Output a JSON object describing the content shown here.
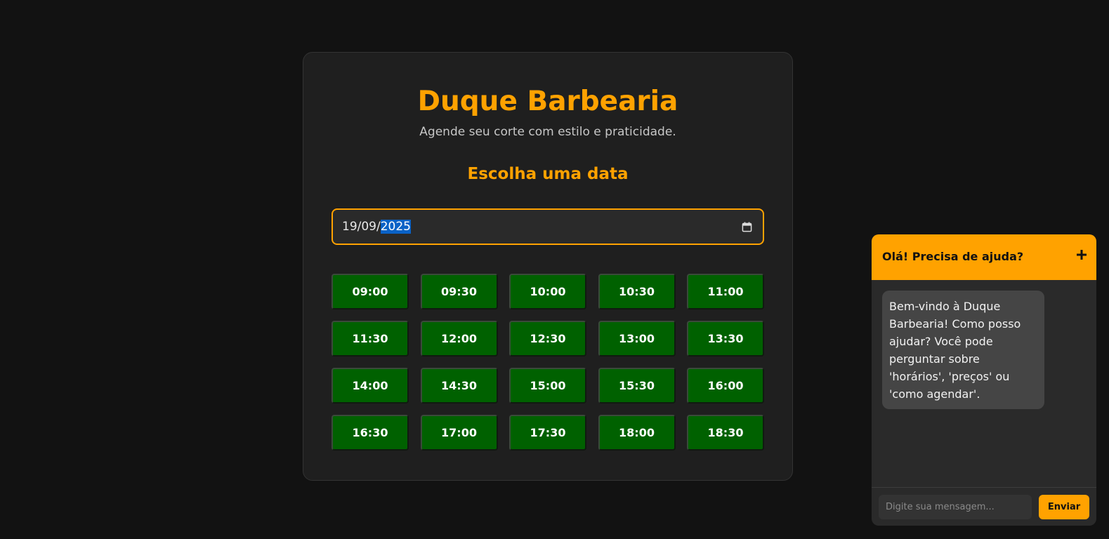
{
  "colors": {
    "background": "#121212",
    "card": "#1f1f1f",
    "accent": "#ffa200",
    "slot_available": "#006100",
    "chat_panel": "#2a2a2a",
    "bubble": "#454545"
  },
  "header": {
    "title": "Duque Barbearia",
    "subtitle": "Agende seu corte com estilo e praticidade."
  },
  "booking": {
    "section_title": "Escolha uma data",
    "date": {
      "day_month": "19/09/",
      "year": "2025",
      "icon": "calendar-icon"
    },
    "slots": [
      "09:00",
      "09:30",
      "10:00",
      "10:30",
      "11:00",
      "11:30",
      "12:00",
      "12:30",
      "13:00",
      "13:30",
      "14:00",
      "14:30",
      "15:00",
      "15:30",
      "16:00",
      "16:30",
      "17:00",
      "17:30",
      "18:00",
      "18:30"
    ]
  },
  "chat": {
    "header_title": "Olá! Precisa de ajuda?",
    "toggle_icon": "plus-icon",
    "welcome_message": "Bem-vindo à Duque Barbearia! Como posso ajudar? Você pode perguntar sobre 'horários', 'preços' ou 'como agendar'.",
    "input_placeholder": "Digite sua mensagem...",
    "send_label": "Enviar"
  }
}
